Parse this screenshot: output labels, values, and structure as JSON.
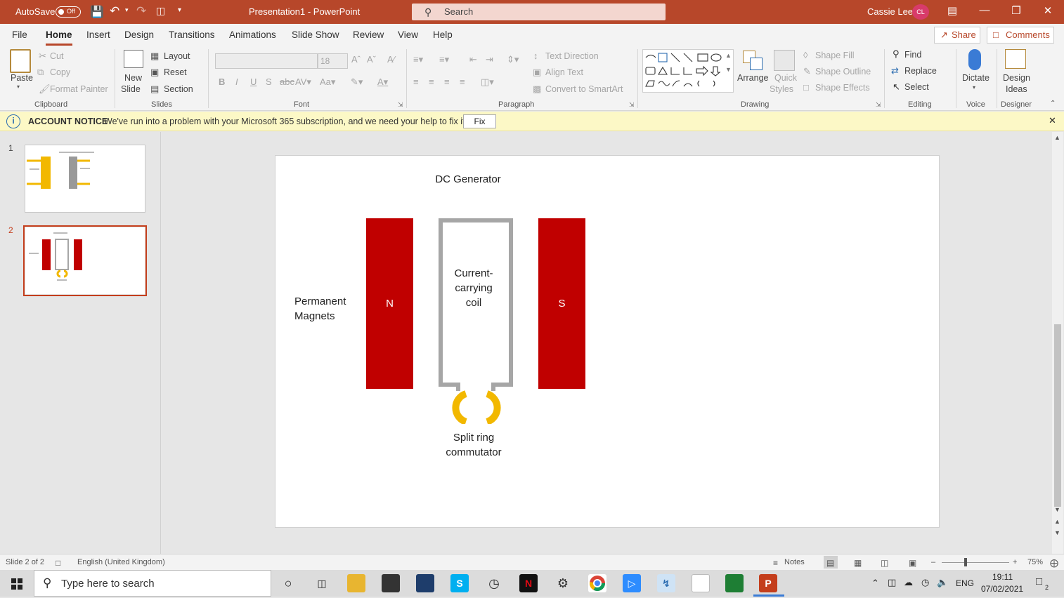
{
  "titlebar": {
    "autosave_label": "AutoSave",
    "autosave_state": "Off",
    "document_title": "Presentation1 - PowerPoint",
    "search_placeholder": "Search",
    "user_name": "Cassie Lee",
    "user_initials": "CL"
  },
  "tabs": [
    "File",
    "Home",
    "Insert",
    "Design",
    "Transitions",
    "Animations",
    "Slide Show",
    "Review",
    "View",
    "Help"
  ],
  "actions": {
    "share": "Share",
    "comments": "Comments"
  },
  "ribbon": {
    "clipboard": {
      "paste": "Paste",
      "cut": "Cut",
      "copy": "Copy",
      "format_painter": "Format Painter",
      "group": "Clipboard"
    },
    "slides": {
      "new_slide_1": "New",
      "new_slide_2": "Slide",
      "layout": "Layout",
      "reset": "Reset",
      "section": "Section",
      "group": "Slides"
    },
    "font": {
      "size": "18",
      "group": "Font"
    },
    "paragraph": {
      "text_direction": "Text Direction",
      "align_text": "Align Text",
      "smartart": "Convert to SmartArt",
      "group": "Paragraph"
    },
    "drawing": {
      "arrange": "Arrange",
      "quick_styles_1": "Quick",
      "quick_styles_2": "Styles",
      "shape_fill": "Shape Fill",
      "shape_outline": "Shape Outline",
      "shape_effects": "Shape Effects",
      "group": "Drawing"
    },
    "editing": {
      "find": "Find",
      "replace": "Replace",
      "select": "Select",
      "group": "Editing"
    },
    "voice": {
      "dictate": "Dictate",
      "group": "Voice"
    },
    "designer": {
      "design_ideas_1": "Design",
      "design_ideas_2": "Ideas",
      "group": "Designer"
    }
  },
  "notice": {
    "heading": "ACCOUNT NOTICE",
    "message": "We've run into a problem with your Microsoft 365 subscription, and we need your help to fix it.",
    "button": "Fix"
  },
  "thumbnails": [
    {
      "number": "1"
    },
    {
      "number": "2"
    }
  ],
  "slide": {
    "title": "DC Generator",
    "magnets_label_1": "Permanent",
    "magnets_label_2": "Magnets",
    "north": "N",
    "south": "S",
    "coil_1": "Current-",
    "coil_2": "carrying",
    "coil_3": "coil",
    "commutator_1": "Split ring",
    "commutator_2": "commutator"
  },
  "colors": {
    "accent": "#b7472a",
    "magnet": "#c00000",
    "coil": "#a6a6a6",
    "commutator": "#f2b800"
  },
  "status": {
    "slide_count": "Slide 2 of 2",
    "language": "English (United Kingdom)",
    "notes": "Notes",
    "zoom": "75%"
  },
  "taskbar": {
    "search_placeholder": "Type here to search",
    "language": "ENG",
    "time": "19:11",
    "date": "07/02/2021",
    "notifications": "2"
  }
}
